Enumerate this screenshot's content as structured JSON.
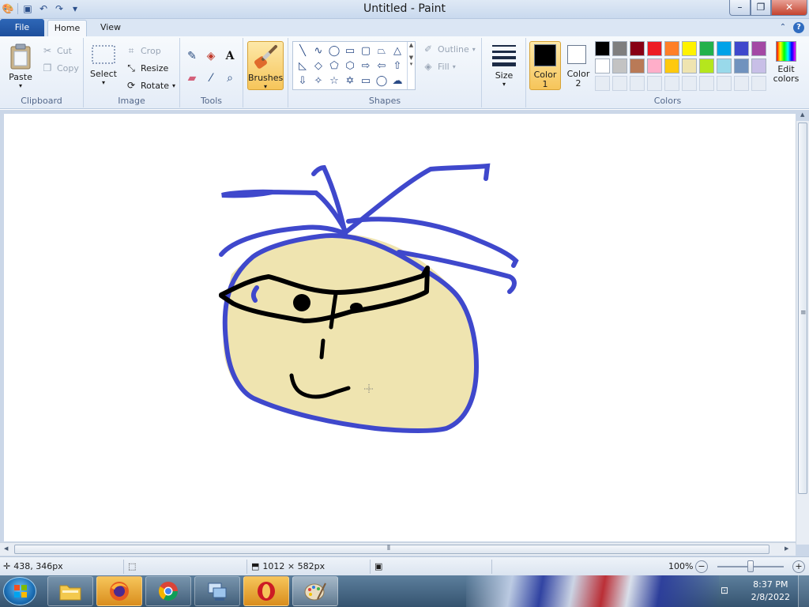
{
  "window": {
    "title": "Untitled - Paint"
  },
  "tabs": {
    "file": "File",
    "home": "Home",
    "view": "View"
  },
  "clipboard": {
    "paste": "Paste",
    "cut": "Cut",
    "copy": "Copy",
    "label": "Clipboard"
  },
  "image": {
    "select": "Select",
    "crop": "Crop",
    "resize": "Resize",
    "rotate": "Rotate",
    "label": "Image"
  },
  "tools": {
    "label": "Tools"
  },
  "brushes": {
    "label": "Brushes"
  },
  "shapes": {
    "outline": "Outline",
    "fill": "Fill",
    "label": "Shapes"
  },
  "size": {
    "label": "Size"
  },
  "colors": {
    "color1": "Color",
    "color1_num": "1",
    "color2": "Color",
    "color2_num": "2",
    "edit": "Edit",
    "edit2": "colors",
    "label": "Colors",
    "color1_value": "#000000",
    "color2_value": "#ffffff",
    "palette_row1": [
      "#000000",
      "#7f7f7f",
      "#880015",
      "#ed1c24",
      "#ff7f27",
      "#fff200",
      "#22b14c",
      "#00a2e8",
      "#3f48cc",
      "#a349a4"
    ],
    "palette_row2": [
      "#ffffff",
      "#c3c3c3",
      "#b97a57",
      "#ffaec9",
      "#ffc90e",
      "#efe4b0",
      "#b5e61d",
      "#99d9ea",
      "#7092be",
      "#c8bfe7"
    ],
    "palette_row3": [
      "#e6ecf4",
      "#e6ecf4",
      "#e6ecf4",
      "#e6ecf4",
      "#e6ecf4",
      "#e6ecf4",
      "#e6ecf4",
      "#e6ecf4",
      "#e6ecf4",
      "#e6ecf4"
    ]
  },
  "drawing": {
    "outline_color": "#3f48cc",
    "face_fill": "#efe4b0",
    "ink_color": "#000000"
  },
  "status": {
    "cursor_pos": "438, 346px",
    "canvas_size": "1012 × 582px",
    "zoom": "100%"
  },
  "taskbar": {
    "time": "8:37 PM",
    "date": "2/8/2022"
  }
}
